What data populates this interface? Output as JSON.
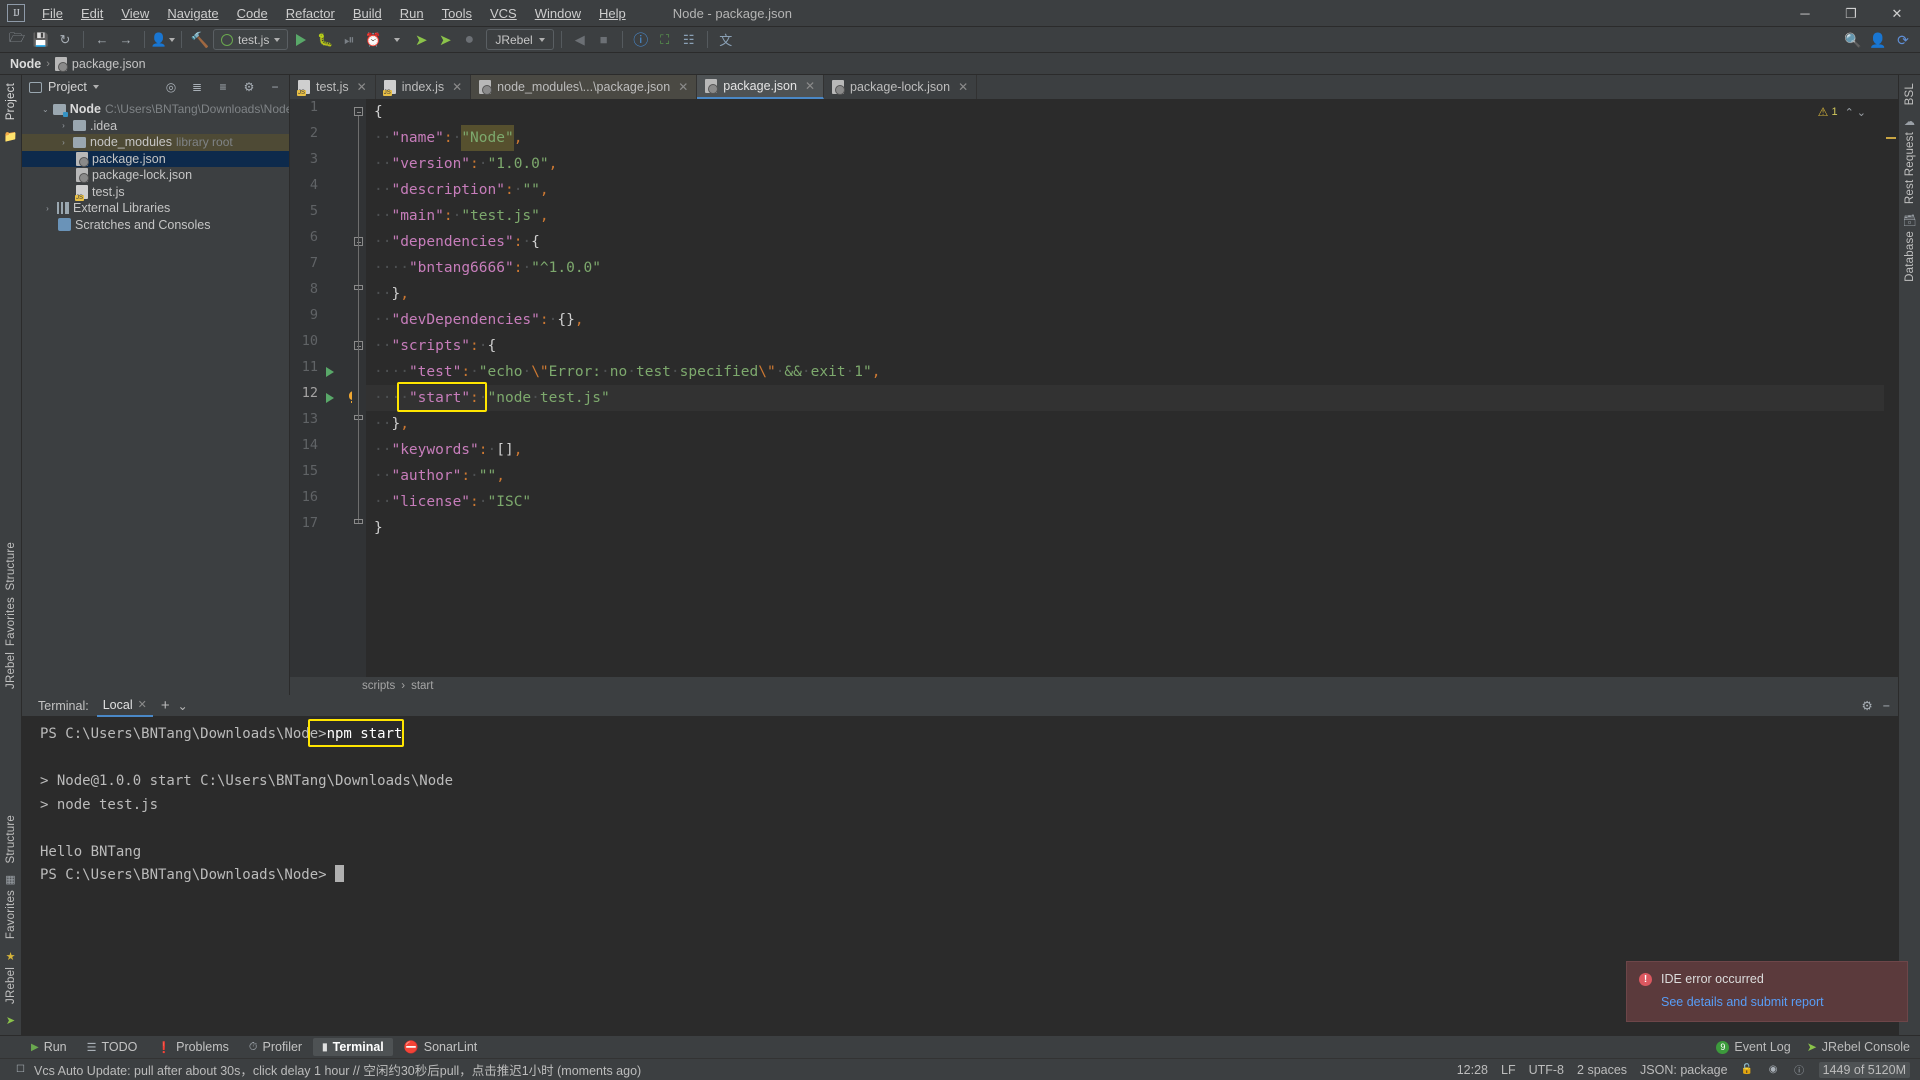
{
  "window": {
    "title": "Node - package.json",
    "logo": "intellij-logo",
    "minimize": "─",
    "maximize": "❐",
    "close": "✕"
  },
  "menu": [
    {
      "label": "File"
    },
    {
      "label": "Edit"
    },
    {
      "label": "View"
    },
    {
      "label": "Navigate"
    },
    {
      "label": "Code"
    },
    {
      "label": "Refactor"
    },
    {
      "label": "Build"
    },
    {
      "label": "Run"
    },
    {
      "label": "Tools"
    },
    {
      "label": "VCS"
    },
    {
      "label": "Window"
    },
    {
      "label": "Help"
    }
  ],
  "toolbar": {
    "run_config": "test.js",
    "jrebel_label": "JRebel",
    "icons": [
      "open-folder-icon",
      "save-icon",
      "sync-icon",
      "back-arrow-icon",
      "forward-arrow-icon",
      "profile-icon",
      "build-hammer-icon"
    ],
    "run_icon": "run-icon",
    "debug_icon": "debug-icon",
    "coverage_icon": "coverage-icon",
    "rerun_icon": "rerun-icon",
    "jrebel_run_icon": "jrebel-run-icon",
    "jrebel_debug_icon": "jrebel-debug-icon",
    "stop_icon": "stop-icon",
    "right_icons": [
      "search-icon",
      "account-icon",
      "updates-icon"
    ]
  },
  "navbar": {
    "project": "Node",
    "file": "package.json",
    "separator": "›"
  },
  "left_stripe": {
    "project_label": "Project",
    "structure_label": "Structure",
    "favorites_label": "Favorites",
    "jrebel_label": "JRebel"
  },
  "right_stripe": {
    "bsl_label": "BSL",
    "rest_label": "Rest Request",
    "database_label": "Database"
  },
  "project_pane": {
    "title": "Project",
    "toolbar_icons": [
      "locate-icon",
      "expand-all-icon",
      "collapse-all-icon",
      "settings-gear-icon",
      "hide-icon"
    ],
    "tree": [
      {
        "label": "Node",
        "detail": "C:\\Users\\BNTang\\Downloads\\Node",
        "indent": 0,
        "arrow": "⌄",
        "icon": "module-folder-icon",
        "bold": true,
        "state": "normal"
      },
      {
        "label": ".idea",
        "detail": "",
        "indent": 1,
        "arrow": "›",
        "icon": "folder-icon",
        "bold": false,
        "state": "normal"
      },
      {
        "label": "node_modules",
        "detail": "library root",
        "indent": 1,
        "arrow": "›",
        "icon": "folder-icon",
        "bold": false,
        "state": "highlight"
      },
      {
        "label": "package.json",
        "detail": "",
        "indent": 2,
        "arrow": "",
        "icon": "json-file-icon",
        "bold": false,
        "state": "selected"
      },
      {
        "label": "package-lock.json",
        "detail": "",
        "indent": 2,
        "arrow": "",
        "icon": "json-file-icon",
        "bold": false,
        "state": "normal"
      },
      {
        "label": "test.js",
        "detail": "",
        "indent": 2,
        "arrow": "",
        "icon": "js-file-icon",
        "bold": false,
        "state": "normal"
      },
      {
        "label": "External Libraries",
        "detail": "",
        "indent": 0,
        "arrow": "›",
        "icon": "library-icon",
        "bold": false,
        "state": "normal"
      },
      {
        "label": "Scratches and Consoles",
        "detail": "",
        "indent": 0,
        "arrow": "",
        "icon": "scratch-icon",
        "bold": false,
        "state": "normal"
      }
    ]
  },
  "editor": {
    "tabs": [
      {
        "label": "test.js",
        "icon": "js-file-icon",
        "active": false,
        "dim": false
      },
      {
        "label": "index.js",
        "icon": "js-file-icon",
        "active": false,
        "dim": false
      },
      {
        "label": "node_modules\\...\\package.json",
        "icon": "json-file-icon",
        "active": false,
        "dim": true
      },
      {
        "label": "package.json",
        "icon": "json-file-icon",
        "active": true,
        "dim": false
      },
      {
        "label": "package-lock.json",
        "icon": "json-file-icon",
        "active": false,
        "dim": false
      }
    ],
    "close_glyph": "✕",
    "warning_count": "1",
    "warning_icon": "warning-triangle-icon",
    "inspection_up": "⌃",
    "inspection_down": "⌄",
    "current_line": 12,
    "lines": [
      {
        "no": 1,
        "text": "{"
      },
      {
        "no": 2,
        "text": "  \"name\": \"Node\","
      },
      {
        "no": 3,
        "text": "  \"version\": \"1.0.0\","
      },
      {
        "no": 4,
        "text": "  \"description\": \"\","
      },
      {
        "no": 5,
        "text": "  \"main\": \"test.js\","
      },
      {
        "no": 6,
        "text": "  \"dependencies\": {"
      },
      {
        "no": 7,
        "text": "    \"bntang6666\": \"^1.0.0\""
      },
      {
        "no": 8,
        "text": "  },"
      },
      {
        "no": 9,
        "text": "  \"devDependencies\": {},"
      },
      {
        "no": 10,
        "text": "  \"scripts\": {"
      },
      {
        "no": 11,
        "text": "    \"test\": \"echo \\\"Error: no test specified\\\" && exit 1\","
      },
      {
        "no": 12,
        "text": "    \"start\": \"node test.js\""
      },
      {
        "no": 13,
        "text": "  },"
      },
      {
        "no": 14,
        "text": "  \"keywords\": [],"
      },
      {
        "no": 15,
        "text": "  \"author\": \"\","
      },
      {
        "no": 16,
        "text": "  \"license\": \"ISC\""
      },
      {
        "no": 17,
        "text": "}"
      }
    ],
    "breadcrumb": [
      "scripts",
      "start"
    ],
    "breadcrumb_sep": "›",
    "highlight_token": "\"start\":"
  },
  "terminal": {
    "label": "Terminal:",
    "tab": "Local",
    "close_glyph": "✕",
    "add_glyph": "+",
    "dropdown_glyph": "⌄",
    "settings_icon": "gear-icon",
    "hide_icon": "minimize-icon",
    "prompt": "PS C:\\Users\\BNTang\\Downloads\\Node>",
    "command": "npm start",
    "output": [
      "",
      "> Node@1.0.0 start C:\\Users\\BNTang\\Downloads\\Node",
      "> node test.js",
      "",
      "Hello BNTang"
    ],
    "final_prompt": "PS C:\\Users\\BNTang\\Downloads\\Node>"
  },
  "notification": {
    "title": "IDE error occurred",
    "link": "See details and submit report",
    "icon": "error-icon",
    "bg_color": "#5b3a3c",
    "link_color": "#589df6"
  },
  "bottom_bar": {
    "items": [
      {
        "label": "Run",
        "icon": "run-icon",
        "active": false
      },
      {
        "label": "TODO",
        "icon": "todo-icon",
        "active": false
      },
      {
        "label": "Problems",
        "icon": "problems-icon",
        "active": false
      },
      {
        "label": "Profiler",
        "icon": "profiler-icon",
        "active": false
      },
      {
        "label": "Terminal",
        "icon": "terminal-icon",
        "active": true
      },
      {
        "label": "SonarLint",
        "icon": "sonarlint-icon",
        "active": false
      }
    ],
    "event_log": "Event Log",
    "event_log_badge": "9",
    "jrebel_console": "JRebel Console"
  },
  "status_bar": {
    "message": "Vcs Auto Update: pull after about 30s，click delay 1 hour // 空闲约30秒后pull，点击推迟1小时 (moments ago)",
    "message_icon": "notification-icon",
    "position": "12:28",
    "line_sep": "LF",
    "encoding": "UTF-8",
    "indent": "2 spaces",
    "schema": "JSON: package",
    "lock_icon": "unlock-icon",
    "inspection_icon": "inspection-icon",
    "error_icon": "error-circle-icon",
    "memory": "1449 of 5120M"
  }
}
